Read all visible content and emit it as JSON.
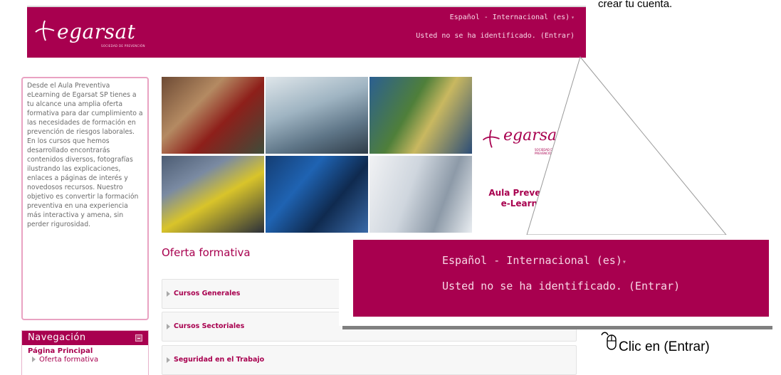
{
  "tip": {
    "top_text": "crear tu cuenta."
  },
  "header": {
    "logo_word": "egarsat",
    "logo_tagline": "SOCIEDAD DE PREVENCIÓN",
    "language": "Español - Internacional (es)",
    "login_prefix": "Usted no se ha identificado. (",
    "login_link": "Entrar",
    "login_suffix": ")"
  },
  "intro": {
    "text": "Desde el Aula Preventiva eLearning de Egarsat SP tienes a tu alcance una amplia oferta formativa para dar cumplimiento a las necesidades de formación en prevención de riesgos laborales. En los cursos que hemos desarrollado encontrarás contenidos diversos, fotografías ilustrando las explicaciones, enlaces a páginas de interés y novedosos recursos. Nuestro objetivo es convertir la formación preventiva en una experiencia más interactiva y amena, sin perder rigurosidad."
  },
  "navigation": {
    "title": "Navegación",
    "home": "Página Principal",
    "items": [
      "Oferta formativa"
    ]
  },
  "banner": {
    "brand_word": "egarsat",
    "brand_tagline": "SOCIEDAD DE PREVENCIÓN",
    "title_line1": "Aula Preventiva",
    "title_line2": "e-Learning"
  },
  "section": {
    "title": "Oferta formativa",
    "courses": [
      "Cursos Generales",
      "Cursos Sectoriales",
      "Seguridad en el Trabajo"
    ]
  },
  "zoom": {
    "language": "Español - Internacional (es)",
    "login": "Usted no se ha identificado. (Entrar)"
  },
  "instruction": {
    "text": "Clic en (Entrar)",
    "icon": "mouse-icon"
  },
  "colors": {
    "brand": "#a8004f",
    "header_text": "#f7d7e6"
  }
}
